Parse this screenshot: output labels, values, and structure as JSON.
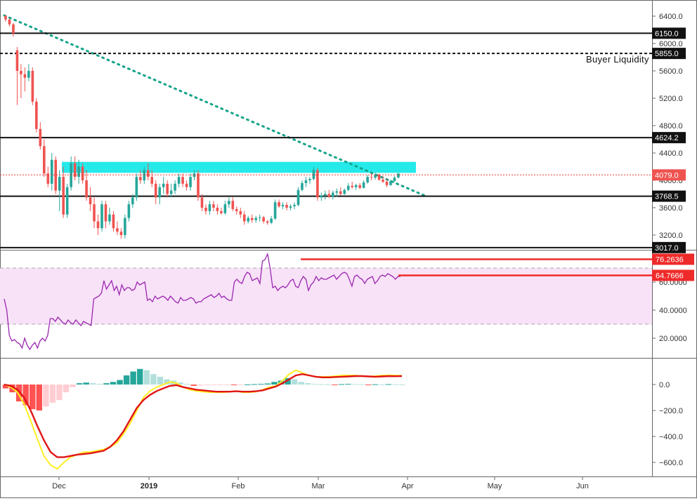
{
  "chart_data": {
    "type": "candlestick",
    "price_panel": {
      "y_ticks": [
        "6400.0",
        "6000.0",
        "5600.0",
        "5200.0",
        "4800.0",
        "4400.0",
        "4000.0",
        "3600.0",
        "3200.0"
      ],
      "ylim": [
        2980,
        6450
      ],
      "last_price": "4079.0",
      "candles": [
        [
          6400,
          6420,
          6320,
          6350
        ],
        [
          6350,
          6370,
          6250,
          6280
        ],
        [
          6280,
          6300,
          6100,
          6150
        ],
        [
          5900,
          5950,
          5100,
          5600
        ],
        [
          5600,
          5700,
          5200,
          5550
        ],
        [
          5550,
          5650,
          5300,
          5500
        ],
        [
          5500,
          5700,
          5450,
          5600
        ],
        [
          5600,
          5650,
          5100,
          5150
        ],
        [
          5150,
          5200,
          4700,
          4750
        ],
        [
          4750,
          4850,
          4450,
          4500
        ],
        [
          4500,
          4600,
          4050,
          4100
        ],
        [
          4100,
          4200,
          3900,
          3950
        ],
        [
          3950,
          4400,
          3850,
          4300
        ],
        [
          4300,
          4350,
          3800,
          3850
        ],
        [
          3850,
          4150,
          3550,
          4050
        ],
        [
          4050,
          4200,
          3450,
          3500
        ],
        [
          3500,
          3950,
          3450,
          3900
        ],
        [
          3900,
          4350,
          3850,
          4250
        ],
        [
          4250,
          4350,
          4000,
          4050
        ],
        [
          4050,
          4300,
          3950,
          4200
        ],
        [
          4200,
          4250,
          3950,
          4000
        ],
        [
          4000,
          4150,
          3700,
          3750
        ],
        [
          3750,
          3900,
          3550,
          3650
        ],
        [
          3650,
          3750,
          3300,
          3400
        ],
        [
          3400,
          3500,
          3200,
          3300
        ],
        [
          3300,
          3700,
          3250,
          3650
        ],
        [
          3650,
          3700,
          3300,
          3400
        ],
        [
          3400,
          3600,
          3350,
          3500
        ],
        [
          3500,
          3550,
          3250,
          3300
        ],
        [
          3300,
          3400,
          3200,
          3250
        ],
        [
          3250,
          3300,
          3150,
          3200
        ],
        [
          3200,
          3500,
          3150,
          3450
        ],
        [
          3450,
          3700,
          3400,
          3650
        ],
        [
          3650,
          3800,
          3600,
          3750
        ],
        [
          3750,
          4100,
          3700,
          4050
        ],
        [
          4050,
          4150,
          3950,
          4000
        ],
        [
          4000,
          4200,
          3950,
          4150
        ],
        [
          4150,
          4250,
          4000,
          4050
        ],
        [
          4050,
          4150,
          3900,
          3950
        ],
        [
          3950,
          4000,
          3650,
          3750
        ],
        [
          3750,
          3950,
          3650,
          3900
        ],
        [
          3900,
          4050,
          3800,
          3950
        ],
        [
          3950,
          4000,
          3750,
          3800
        ],
        [
          3800,
          3950,
          3750,
          3850
        ],
        [
          3850,
          4000,
          3800,
          3950
        ],
        [
          3950,
          4100,
          3900,
          4050
        ],
        [
          4050,
          4100,
          3900,
          3950
        ],
        [
          3950,
          4000,
          3850,
          3900
        ],
        [
          3900,
          4100,
          3850,
          4050
        ],
        [
          4050,
          4150,
          4000,
          4100
        ],
        [
          4100,
          4150,
          3700,
          3750
        ],
        [
          3750,
          3800,
          3550,
          3600
        ],
        [
          3600,
          3650,
          3500,
          3550
        ],
        [
          3550,
          3700,
          3500,
          3650
        ],
        [
          3650,
          3700,
          3550,
          3600
        ],
        [
          3600,
          3650,
          3500,
          3550
        ],
        [
          3550,
          3600,
          3500,
          3520
        ],
        [
          3520,
          3700,
          3500,
          3650
        ],
        [
          3650,
          3750,
          3600,
          3700
        ],
        [
          3700,
          3750,
          3550,
          3580
        ],
        [
          3580,
          3620,
          3500,
          3550
        ],
        [
          3550,
          3600,
          3450,
          3500
        ],
        [
          3500,
          3550,
          3350,
          3400
        ],
        [
          3400,
          3480,
          3370,
          3450
        ],
        [
          3450,
          3500,
          3380,
          3420
        ],
        [
          3420,
          3480,
          3380,
          3450
        ],
        [
          3450,
          3500,
          3400,
          3460
        ],
        [
          3460,
          3480,
          3370,
          3400
        ],
        [
          3400,
          3420,
          3350,
          3380
        ],
        [
          3380,
          3480,
          3360,
          3440
        ],
        [
          3440,
          3720,
          3420,
          3680
        ],
        [
          3680,
          3720,
          3600,
          3620
        ],
        [
          3620,
          3680,
          3580,
          3640
        ],
        [
          3640,
          3680,
          3560,
          3600
        ],
        [
          3600,
          3650,
          3560,
          3620
        ],
        [
          3620,
          3680,
          3580,
          3640
        ],
        [
          3640,
          3900,
          3620,
          3860
        ],
        [
          3860,
          4000,
          3840,
          3960
        ],
        [
          3960,
          4050,
          3900,
          4000
        ],
        [
          4000,
          4050,
          3950,
          4020
        ],
        [
          4020,
          4200,
          4000,
          4150
        ],
        [
          4150,
          4180,
          3700,
          3750
        ],
        [
          3750,
          3820,
          3700,
          3780
        ],
        [
          3780,
          3850,
          3720,
          3800
        ],
        [
          3800,
          3860,
          3740,
          3760
        ],
        [
          3760,
          3850,
          3720,
          3820
        ],
        [
          3820,
          3880,
          3760,
          3840
        ],
        [
          3840,
          3900,
          3780,
          3800
        ],
        [
          3800,
          3880,
          3790,
          3860
        ],
        [
          3860,
          3960,
          3840,
          3920
        ],
        [
          3920,
          3980,
          3880,
          3900
        ],
        [
          3900,
          3950,
          3860,
          3930
        ],
        [
          3930,
          3960,
          3870,
          3890
        ],
        [
          3890,
          4000,
          3880,
          3970
        ],
        [
          3970,
          4080,
          3950,
          4050
        ],
        [
          4050,
          4100,
          4000,
          4040
        ],
        [
          4040,
          4110,
          4010,
          4080
        ],
        [
          4080,
          4100,
          3990,
          4010
        ],
        [
          4010,
          4060,
          3960,
          3980
        ],
        [
          3980,
          4020,
          3900,
          3930
        ],
        [
          3930,
          4010,
          3920,
          3990
        ],
        [
          3990,
          4060,
          3980,
          4040
        ],
        [
          4040,
          4110,
          4030,
          4100
        ]
      ]
    },
    "levels": [
      {
        "value": "6150.0",
        "style": "solid"
      },
      {
        "value": "5855.0",
        "style": "dashed"
      },
      {
        "value": "4624.2",
        "style": "solid"
      },
      {
        "value": "3768.5",
        "style": "solid"
      },
      {
        "value": "3017.0",
        "style": "solid"
      }
    ],
    "annotation": "Buyer Liquidity",
    "zone": {
      "low": 4110,
      "high": 4270
    },
    "rsi_panel": {
      "y_ticks": [
        "60.0000",
        "40.0000",
        "20.0000"
      ],
      "ylim": [
        0,
        100
      ],
      "bands": [
        30,
        70
      ],
      "labels": [
        "76.2636",
        "64.7666"
      ],
      "values": [
        48,
        40,
        22,
        18,
        19,
        17,
        16,
        13,
        20,
        15,
        12,
        15,
        17,
        13,
        18,
        20,
        18,
        22,
        34,
        34,
        32,
        35,
        33,
        31,
        30,
        33,
        31,
        30,
        33,
        31,
        29,
        32,
        31,
        30,
        29,
        48,
        49,
        50,
        52,
        61,
        55,
        58,
        61,
        54,
        57,
        51,
        58,
        54,
        56,
        56,
        54,
        55,
        60,
        58,
        59,
        60,
        47,
        48,
        46,
        50,
        48,
        49,
        50,
        49,
        47,
        50,
        48,
        46,
        45,
        49,
        47,
        47,
        48,
        49,
        48,
        45,
        46,
        46,
        48,
        49,
        50,
        51,
        49,
        50,
        52,
        49,
        50,
        48,
        47,
        47,
        60,
        62,
        60,
        59,
        64,
        67,
        66,
        61,
        62,
        63,
        59,
        75,
        76,
        80,
        70,
        56,
        57,
        54,
        56,
        57,
        56,
        58,
        61,
        62,
        57,
        56,
        61,
        64,
        62,
        54,
        58,
        60,
        64,
        61,
        63,
        62,
        62,
        63,
        64,
        65,
        62,
        64,
        66,
        67,
        66,
        62,
        57,
        64,
        65,
        63,
        62,
        59,
        62,
        63,
        64,
        59,
        61,
        64,
        65,
        64,
        66,
        65,
        64,
        62,
        64,
        64
      ]
    },
    "macd_panel": {
      "y_ticks": [
        "0.0",
        "−200.0",
        "−400.0",
        "−600.0"
      ],
      "ylim": [
        -700,
        180
      ],
      "macd": [
        0,
        -20,
        -60,
        -150,
        -280,
        -420,
        -550,
        -620,
        -650,
        -600,
        -560,
        -540,
        -520,
        -520,
        -510,
        -500,
        -480,
        -450,
        -380,
        -300,
        -200,
        -100,
        -50,
        -20,
        0,
        20,
        10,
        -20,
        -40,
        -50,
        -55,
        -60,
        -60,
        -60,
        -55,
        -50,
        -60,
        -60,
        -55,
        -40,
        -20,
        -10,
        30,
        80,
        110,
        90,
        70,
        60,
        60,
        60,
        65,
        70,
        70,
        70,
        65,
        62,
        65,
        70,
        72,
        70,
        68
      ],
      "signal": [
        0,
        -10,
        -40,
        -100,
        -200,
        -320,
        -430,
        -520,
        -560,
        -560,
        -550,
        -540,
        -535,
        -530,
        -520,
        -510,
        -480,
        -430,
        -360,
        -270,
        -180,
        -120,
        -80,
        -50,
        -30,
        -10,
        -5,
        -20,
        -30,
        -40,
        -45,
        -50,
        -55,
        -55,
        -55,
        -52,
        -55,
        -55,
        -52,
        -45,
        -30,
        -15,
        10,
        40,
        70,
        80,
        70,
        60,
        55,
        55,
        58,
        60,
        62,
        65,
        65,
        62,
        60,
        62,
        65,
        64,
        65
      ],
      "hist": [
        -30,
        -60,
        -130,
        -160,
        -190,
        -200,
        -170,
        -140,
        -120,
        -60,
        -20,
        10,
        15,
        10,
        5,
        10,
        20,
        35,
        70,
        100,
        120,
        110,
        80,
        60,
        40,
        30,
        15,
        5,
        -10,
        -8,
        -6,
        -4,
        -3,
        -2,
        -2,
        -1,
        1,
        3,
        5,
        8,
        20,
        30,
        50,
        40,
        20,
        10,
        5,
        3,
        2,
        -2,
        3,
        5,
        4,
        3,
        -2,
        2,
        1,
        3,
        2,
        1
      ]
    },
    "x_ticks": [
      "Dec",
      "2019",
      "Feb",
      "Mar",
      "Apr",
      "May",
      "Jun"
    ]
  }
}
